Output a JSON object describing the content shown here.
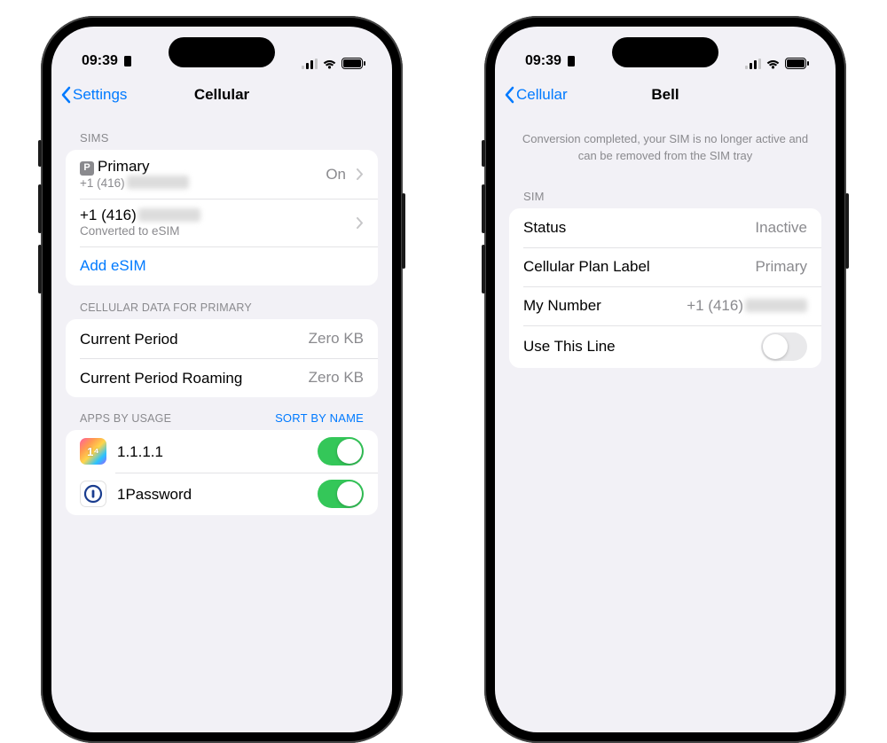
{
  "statusbar": {
    "time": "09:39"
  },
  "left": {
    "nav": {
      "back": "Settings",
      "title": "Cellular"
    },
    "sims": {
      "header": "SIMs",
      "item0": {
        "badge": "P",
        "title": "Primary",
        "number_prefix": "+1 (416)",
        "status": "On"
      },
      "item1": {
        "number_prefix": "+1 (416)",
        "sub": "Converted to eSIM"
      },
      "add": "Add eSIM"
    },
    "data": {
      "header": "CELLULAR DATA FOR PRIMARY",
      "current": {
        "label": "Current Period",
        "value": "Zero KB"
      },
      "roaming": {
        "label": "Current Period Roaming",
        "value": "Zero KB"
      }
    },
    "apps": {
      "header": "APPS BY USAGE",
      "sort": "SORT BY NAME",
      "list": {
        "0": {
          "name": "1.1.1.1",
          "on": true,
          "icon_label": "1⁴"
        },
        "1": {
          "name": "1Password",
          "on": true
        }
      }
    }
  },
  "right": {
    "nav": {
      "back": "Cellular",
      "title": "Bell"
    },
    "note": "Conversion completed, your SIM is no longer active and can be removed from the SIM tray",
    "sim": {
      "header": "SIM",
      "status": {
        "label": "Status",
        "value": "Inactive"
      },
      "plan": {
        "label": "Cellular Plan Label",
        "value": "Primary"
      },
      "number": {
        "label": "My Number",
        "value_prefix": "+1 (416)"
      },
      "use": {
        "label": "Use This Line",
        "on": false
      }
    }
  }
}
